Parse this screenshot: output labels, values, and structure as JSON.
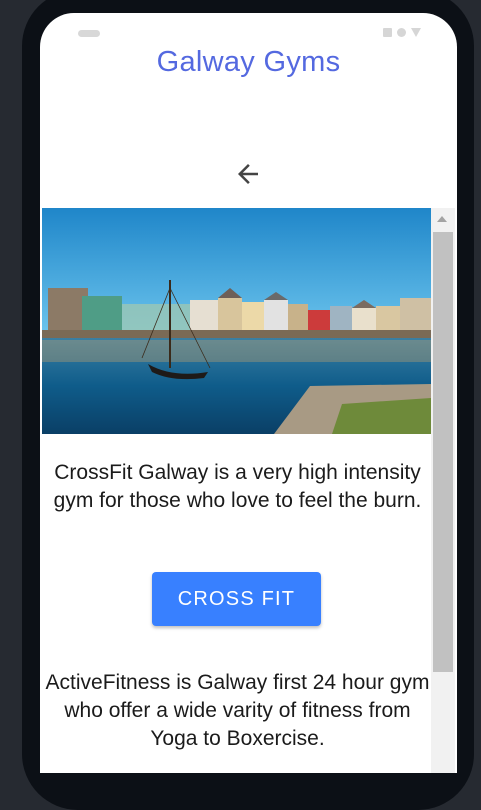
{
  "app": {
    "title": "Galway Gyms"
  },
  "nav": {
    "back_icon": "arrow-left-icon"
  },
  "hero": {
    "alt": "Galway harbour with colourful houses and a sailing boat"
  },
  "gyms": [
    {
      "description": "CrossFit Galway is a very high intensity gym for those who love to feel the burn.",
      "button_label": "CROSS FIT"
    },
    {
      "description": "ActiveFitness is Galway first 24 hour gym who offer a wide varity of fitness from Yoga to Boxercise."
    }
  ],
  "colors": {
    "title": "#5469e0",
    "button": "#3880ff",
    "background": "#262a31"
  }
}
